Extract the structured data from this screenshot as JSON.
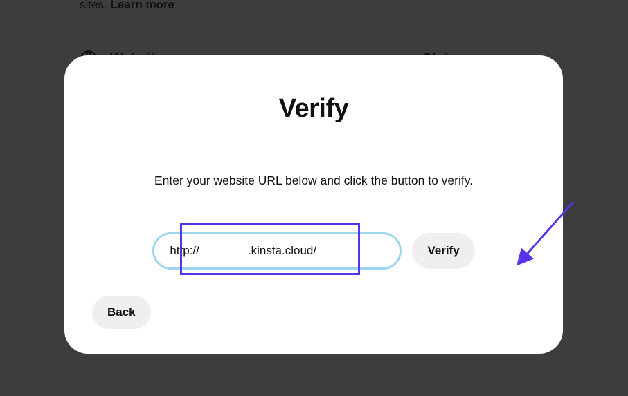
{
  "background": {
    "text_fragment": "sites.",
    "learn_more": "Learn more",
    "section_label": "Websites",
    "claim_label": "Claim"
  },
  "modal": {
    "title": "Verify",
    "subtitle": "Enter your website URL below and click the button to verify.",
    "url_prefix": "http://",
    "url_suffix": ".kinsta.cloud/",
    "verify_button": "Verify",
    "back_button": "Back"
  }
}
